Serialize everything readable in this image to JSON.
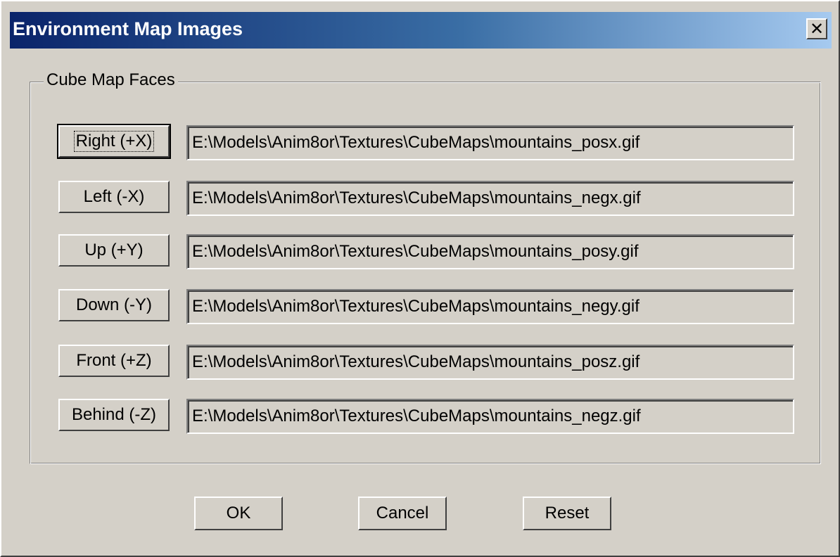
{
  "window": {
    "title": "Environment Map Images",
    "close_glyph": "✕",
    "close_icon": "close-icon"
  },
  "group": {
    "legend": "Cube Map Faces"
  },
  "faces": [
    {
      "button_label": "Right (+X)",
      "path": "E:\\Models\\Anim8or\\Textures\\CubeMaps\\mountains_posx.gif"
    },
    {
      "button_label": "Left (-X)",
      "path": "E:\\Models\\Anim8or\\Textures\\CubeMaps\\mountains_negx.gif"
    },
    {
      "button_label": "Up (+Y)",
      "path": "E:\\Models\\Anim8or\\Textures\\CubeMaps\\mountains_posy.gif"
    },
    {
      "button_label": "Down (-Y)",
      "path": "E:\\Models\\Anim8or\\Textures\\CubeMaps\\mountains_negy.gif"
    },
    {
      "button_label": "Front (+Z)",
      "path": "E:\\Models\\Anim8or\\Textures\\CubeMaps\\mountains_posz.gif"
    },
    {
      "button_label": "Behind (-Z)",
      "path": "E:\\Models\\Anim8or\\Textures\\CubeMaps\\mountains_negz.gif"
    }
  ],
  "actions": {
    "ok_label": "OK",
    "cancel_label": "Cancel",
    "reset_label": "Reset"
  },
  "colors": {
    "face": "#d4d0c8",
    "title_start": "#0a246a",
    "title_end": "#a6caf0"
  }
}
